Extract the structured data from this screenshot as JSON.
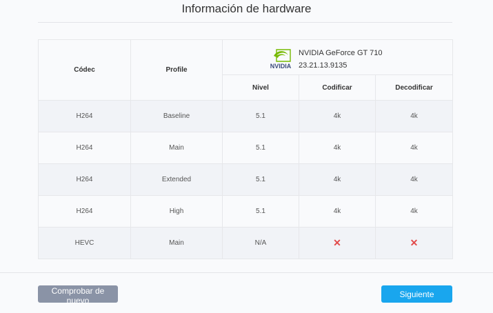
{
  "title": "Información de hardware",
  "table": {
    "header": {
      "codec": "Códec",
      "profile": "Profile",
      "gpu_name": "NVIDIA GeForce GT 710",
      "gpu_driver": "23.21.13.9135",
      "gpu_logo_text": "NVIDIA",
      "level": "Nivel",
      "encode": "Codificar",
      "decode": "Decodificar"
    },
    "rows": [
      {
        "codec": "H264",
        "profile": "Baseline",
        "level": "5.1",
        "encode": "4k",
        "decode": "4k"
      },
      {
        "codec": "H264",
        "profile": "Main",
        "level": "5.1",
        "encode": "4k",
        "decode": "4k"
      },
      {
        "codec": "H264",
        "profile": "Extended",
        "level": "5.1",
        "encode": "4k",
        "decode": "4k"
      },
      {
        "codec": "H264",
        "profile": "High",
        "level": "5.1",
        "encode": "4k",
        "decode": "4k"
      },
      {
        "codec": "HEVC",
        "profile": "Main",
        "level": "N/A",
        "encode": "✕",
        "decode": "✕"
      }
    ]
  },
  "icons": {
    "unsupported": "x-icon",
    "brand": "nvidia-logo-icon"
  },
  "colors": {
    "accent": "#19a6ee",
    "secondary_button": "#8a93a6",
    "error": "#e24a4a",
    "nvidia_green": "#76b900"
  },
  "buttons": {
    "recheck": "Comprobar de nuevo",
    "next": "Siguiente"
  }
}
